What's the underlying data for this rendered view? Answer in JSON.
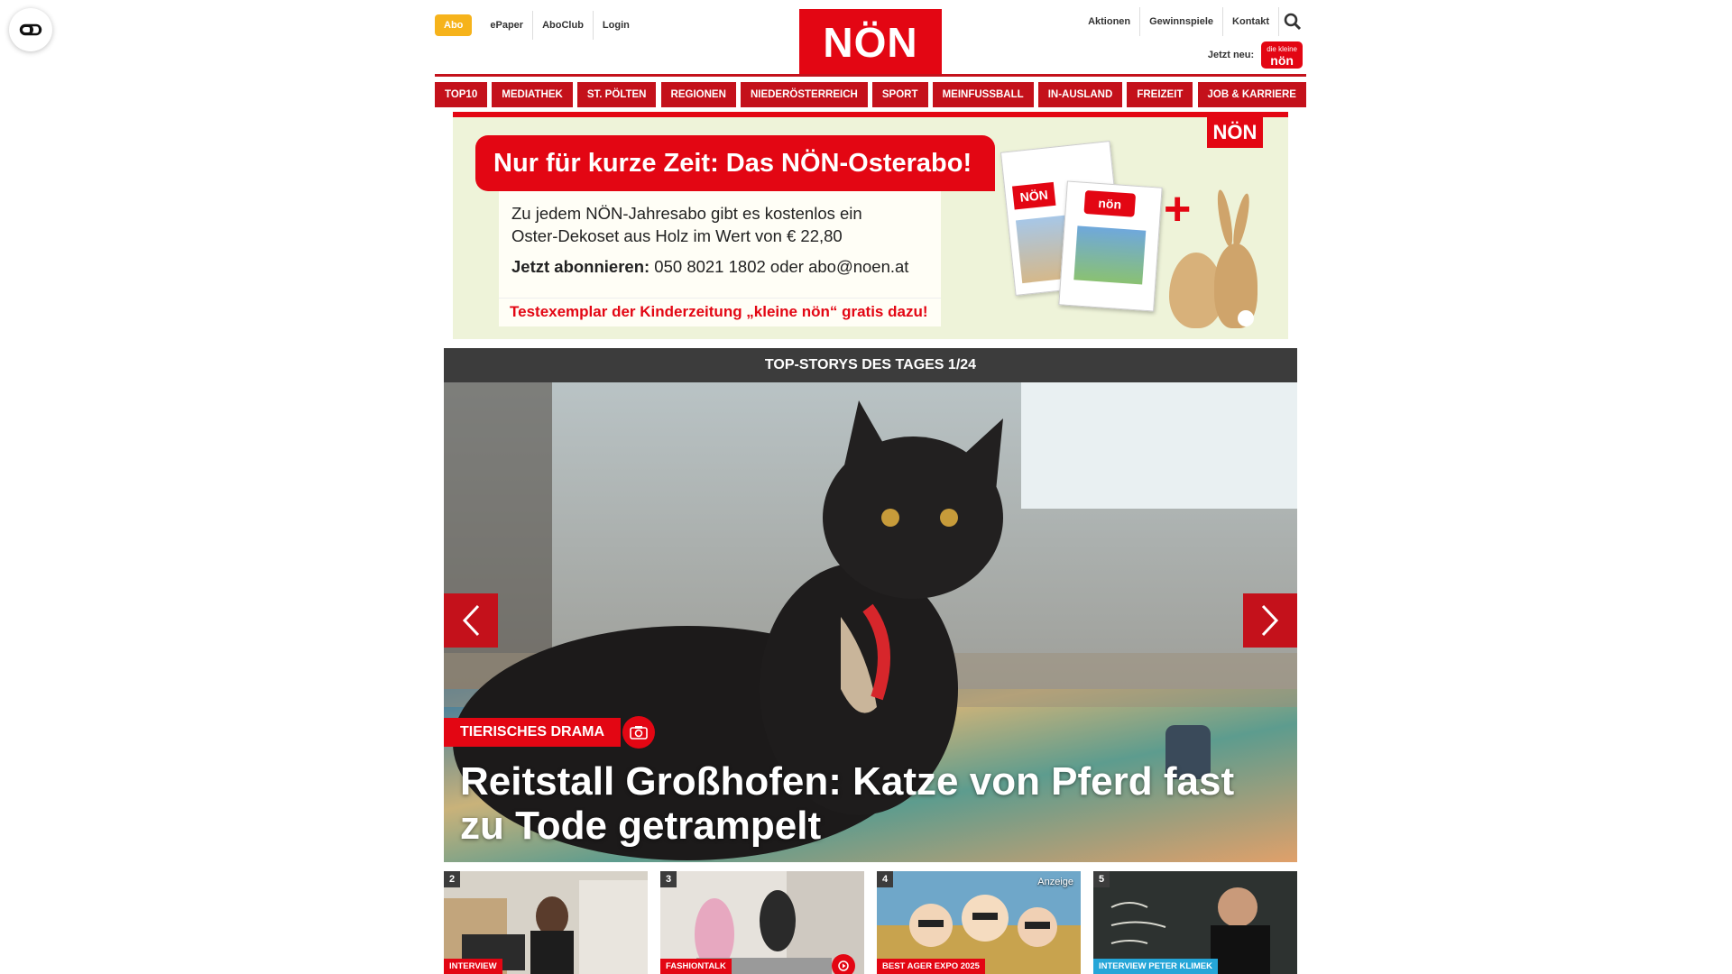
{
  "colors": {
    "brand_red": "#e30613",
    "nav_red": "#c4111b",
    "abo_yellow": "#f6b31b",
    "dark_bar": "#3c3c3c"
  },
  "header": {
    "abo_label": "Abo",
    "left_links": [
      "ePaper",
      "AboClub",
      "Login"
    ],
    "logo": "NÖN",
    "right_links": [
      "Aktionen",
      "Gewinnspiele",
      "Kontakt"
    ],
    "jetzt_neu": "Jetzt neu:",
    "kleine_noen": {
      "line1": "die kleine",
      "line2": "nön"
    }
  },
  "nav": [
    "TOP10",
    "MEDIATHEK",
    "ST. PÖLTEN",
    "REGIONEN",
    "NIEDERÖSTERREICH",
    "SPORT",
    "MEINFUSSBALL",
    "IN-AUSLAND",
    "FREIZEIT",
    "JOB & KARRIERE"
  ],
  "ad": {
    "headline": "Nur für kurze Zeit: Das NÖN-Osterabo!",
    "body_line1": "Zu jedem NÖN-Jahresabo gibt es kostenlos ein",
    "body_line2": "Oster-Dekoset aus Holz im Wert von € 22,80",
    "cta_bold": "Jetzt abonnieren:",
    "cta_rest": " 050 8021 1802 oder abo@noen.at",
    "test": "Testexemplar der Kinderzeitung „kleine nön“ gratis dazu!",
    "logo": "NÖN",
    "mag1": "NÖN",
    "mag2": "nön"
  },
  "topstories": {
    "bar": "TOP-STORYS DES TAGES 1/24",
    "tag": "TIERISCHES DRAMA",
    "headline_white1": "Reitstall Großhofen: ",
    "headline_line2": "zu Tode getrampelt",
    "headline_yellow": "Katze von Pferd fast"
  },
  "thumbs": [
    {
      "num": "2",
      "tag": "INTERVIEW",
      "tag_color": "red"
    },
    {
      "num": "3",
      "tag": "FASHIONTALK",
      "tag_color": "red"
    },
    {
      "num": "4",
      "tag": "BEST AGER EXPO 2025",
      "tag_color": "red",
      "ad": "Anzeige"
    },
    {
      "num": "5",
      "tag": "INTERVIEW PETER KLIMEK",
      "tag_color": "blue"
    }
  ]
}
